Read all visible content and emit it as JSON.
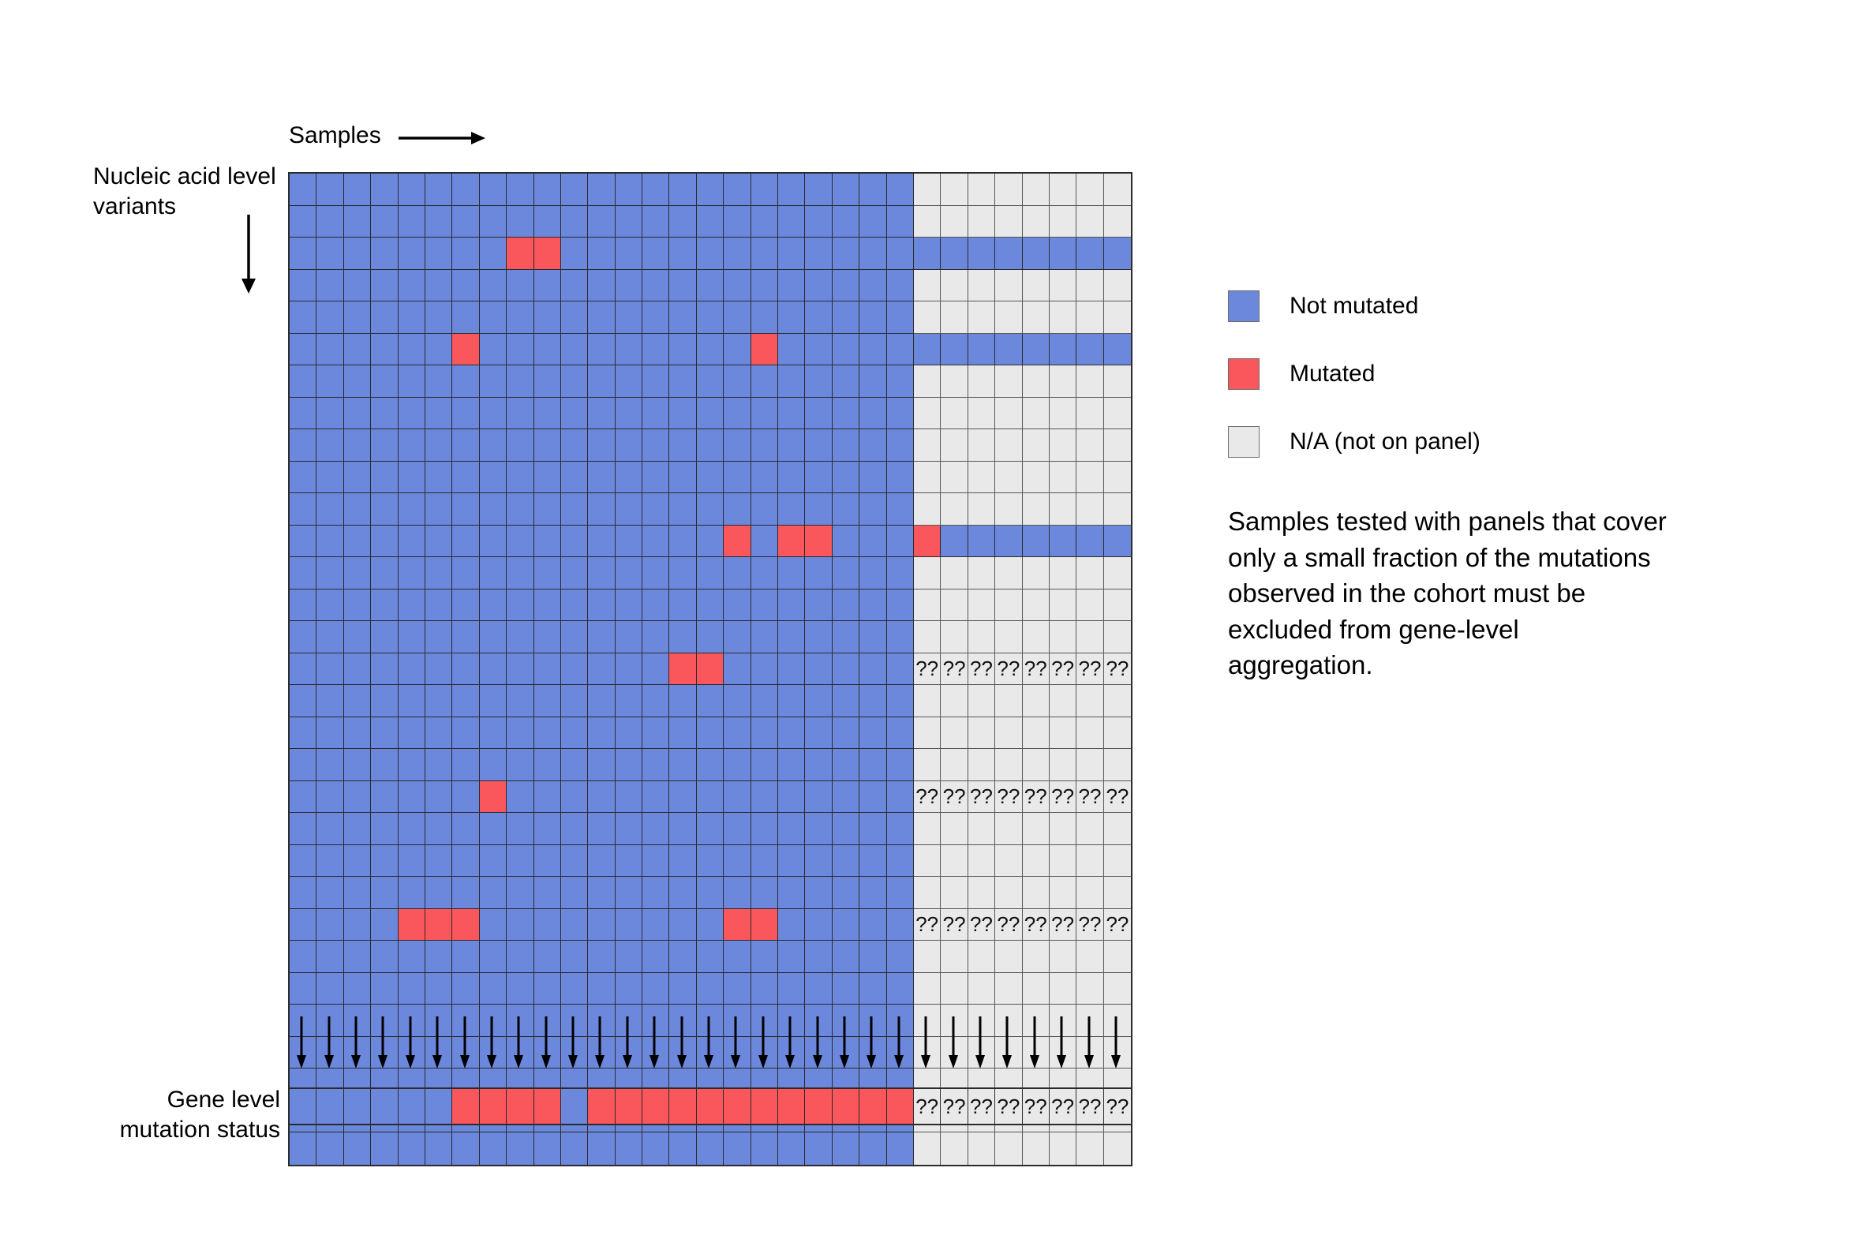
{
  "labels": {
    "samples": "Samples",
    "nucleic_acid_variants": "Nucleic acid level\nvariants",
    "gene_level": "Gene level\nmutation status"
  },
  "legend": {
    "items": [
      {
        "label": "Not mutated",
        "color": "#6b88dd",
        "state": "blue"
      },
      {
        "label": "Mutated",
        "color": "#f9575c",
        "state": "red"
      },
      {
        "label": "N/A (not on panel)",
        "color": "#e9e9e9",
        "state": "na"
      }
    ]
  },
  "note": "Samples tested with panels that cover only a small fraction of the mutations observed in the cohort must be excluded from gene-level aggregation.",
  "unknown_marker": "?",
  "chart_data": {
    "type": "heatmap",
    "title": "Nucleic acid level variants by sample",
    "xlabel": "Samples",
    "ylabel": "Nucleic acid level variants",
    "columns": 31,
    "rows": 26,
    "panel_covered_columns": 23,
    "not_on_panel_columns": 8,
    "legend_position": "right",
    "value_colors": {
      "blue": "#6b88dd",
      "red": "#f9575c",
      "na": "#e9e9e9"
    },
    "matrix": [
      [
        "blue",
        "blue",
        "blue",
        "blue",
        "blue",
        "blue",
        "blue",
        "blue",
        "blue",
        "blue",
        "blue",
        "blue",
        "blue",
        "blue",
        "blue",
        "blue",
        "blue",
        "blue",
        "blue",
        "blue",
        "blue",
        "blue",
        "blue",
        "na",
        "na",
        "na",
        "na",
        "na",
        "na",
        "na",
        "na"
      ],
      [
        "blue",
        "blue",
        "blue",
        "blue",
        "blue",
        "blue",
        "blue",
        "blue",
        "blue",
        "blue",
        "blue",
        "blue",
        "blue",
        "blue",
        "blue",
        "blue",
        "blue",
        "blue",
        "blue",
        "blue",
        "blue",
        "blue",
        "blue",
        "na",
        "na",
        "na",
        "na",
        "na",
        "na",
        "na",
        "na"
      ],
      [
        "blue",
        "blue",
        "blue",
        "blue",
        "blue",
        "blue",
        "blue",
        "blue",
        "red",
        "red",
        "blue",
        "blue",
        "blue",
        "blue",
        "blue",
        "blue",
        "blue",
        "blue",
        "blue",
        "blue",
        "blue",
        "blue",
        "blue",
        "blue",
        "blue",
        "blue",
        "blue",
        "blue",
        "blue",
        "blue",
        "blue"
      ],
      [
        "blue",
        "blue",
        "blue",
        "blue",
        "blue",
        "blue",
        "blue",
        "blue",
        "blue",
        "blue",
        "blue",
        "blue",
        "blue",
        "blue",
        "blue",
        "blue",
        "blue",
        "blue",
        "blue",
        "blue",
        "blue",
        "blue",
        "blue",
        "na",
        "na",
        "na",
        "na",
        "na",
        "na",
        "na",
        "na"
      ],
      [
        "blue",
        "blue",
        "blue",
        "blue",
        "blue",
        "blue",
        "blue",
        "blue",
        "blue",
        "blue",
        "blue",
        "blue",
        "blue",
        "blue",
        "blue",
        "blue",
        "blue",
        "blue",
        "blue",
        "blue",
        "blue",
        "blue",
        "blue",
        "na",
        "na",
        "na",
        "na",
        "na",
        "na",
        "na",
        "na"
      ],
      [
        "blue",
        "blue",
        "blue",
        "blue",
        "blue",
        "blue",
        "red",
        "blue",
        "blue",
        "blue",
        "blue",
        "blue",
        "blue",
        "blue",
        "blue",
        "blue",
        "blue",
        "red",
        "blue",
        "blue",
        "blue",
        "blue",
        "blue",
        "blue",
        "blue",
        "blue",
        "blue",
        "blue",
        "blue",
        "blue",
        "blue"
      ],
      [
        "blue",
        "blue",
        "blue",
        "blue",
        "blue",
        "blue",
        "blue",
        "blue",
        "blue",
        "blue",
        "blue",
        "blue",
        "blue",
        "blue",
        "blue",
        "blue",
        "blue",
        "blue",
        "blue",
        "blue",
        "blue",
        "blue",
        "blue",
        "na",
        "na",
        "na",
        "na",
        "na",
        "na",
        "na",
        "na"
      ],
      [
        "blue",
        "blue",
        "blue",
        "blue",
        "blue",
        "blue",
        "blue",
        "blue",
        "blue",
        "blue",
        "blue",
        "blue",
        "blue",
        "blue",
        "blue",
        "blue",
        "blue",
        "blue",
        "blue",
        "blue",
        "blue",
        "blue",
        "blue",
        "na",
        "na",
        "na",
        "na",
        "na",
        "na",
        "na",
        "na"
      ],
      [
        "blue",
        "blue",
        "blue",
        "blue",
        "blue",
        "blue",
        "blue",
        "blue",
        "blue",
        "blue",
        "blue",
        "blue",
        "blue",
        "blue",
        "blue",
        "blue",
        "blue",
        "blue",
        "blue",
        "blue",
        "blue",
        "blue",
        "blue",
        "na",
        "na",
        "na",
        "na",
        "na",
        "na",
        "na",
        "na"
      ],
      [
        "blue",
        "blue",
        "blue",
        "blue",
        "blue",
        "blue",
        "blue",
        "blue",
        "blue",
        "blue",
        "blue",
        "blue",
        "blue",
        "blue",
        "blue",
        "blue",
        "blue",
        "blue",
        "blue",
        "blue",
        "blue",
        "blue",
        "blue",
        "na",
        "na",
        "na",
        "na",
        "na",
        "na",
        "na",
        "na"
      ],
      [
        "blue",
        "blue",
        "blue",
        "blue",
        "blue",
        "blue",
        "blue",
        "blue",
        "blue",
        "blue",
        "blue",
        "blue",
        "blue",
        "blue",
        "blue",
        "blue",
        "blue",
        "blue",
        "blue",
        "blue",
        "blue",
        "blue",
        "blue",
        "na",
        "na",
        "na",
        "na",
        "na",
        "na",
        "na",
        "na"
      ],
      [
        "blue",
        "blue",
        "blue",
        "blue",
        "blue",
        "blue",
        "blue",
        "blue",
        "blue",
        "blue",
        "blue",
        "blue",
        "blue",
        "blue",
        "blue",
        "blue",
        "red",
        "blue",
        "red",
        "red",
        "blue",
        "blue",
        "blue",
        "red",
        "blue",
        "blue",
        "blue",
        "blue",
        "blue",
        "blue",
        "blue"
      ],
      [
        "blue",
        "blue",
        "blue",
        "blue",
        "blue",
        "blue",
        "blue",
        "blue",
        "blue",
        "blue",
        "blue",
        "blue",
        "blue",
        "blue",
        "blue",
        "blue",
        "blue",
        "blue",
        "blue",
        "blue",
        "blue",
        "blue",
        "blue",
        "na",
        "na",
        "na",
        "na",
        "na",
        "na",
        "na",
        "na"
      ],
      [
        "blue",
        "blue",
        "blue",
        "blue",
        "blue",
        "blue",
        "blue",
        "blue",
        "blue",
        "blue",
        "blue",
        "blue",
        "blue",
        "blue",
        "blue",
        "blue",
        "blue",
        "blue",
        "blue",
        "blue",
        "blue",
        "blue",
        "blue",
        "na",
        "na",
        "na",
        "na",
        "na",
        "na",
        "na",
        "na"
      ],
      [
        "blue",
        "blue",
        "blue",
        "blue",
        "blue",
        "blue",
        "blue",
        "blue",
        "blue",
        "blue",
        "blue",
        "blue",
        "blue",
        "blue",
        "blue",
        "blue",
        "blue",
        "blue",
        "blue",
        "blue",
        "blue",
        "blue",
        "blue",
        "na",
        "na",
        "na",
        "na",
        "na",
        "na",
        "na",
        "na"
      ],
      [
        "blue",
        "blue",
        "blue",
        "blue",
        "blue",
        "blue",
        "blue",
        "blue",
        "blue",
        "blue",
        "blue",
        "blue",
        "blue",
        "blue",
        "red",
        "red",
        "blue",
        "blue",
        "blue",
        "blue",
        "blue",
        "blue",
        "blue",
        "q",
        "q",
        "q",
        "q",
        "q",
        "q",
        "q",
        "q"
      ],
      [
        "blue",
        "blue",
        "blue",
        "blue",
        "blue",
        "blue",
        "blue",
        "blue",
        "blue",
        "blue",
        "blue",
        "blue",
        "blue",
        "blue",
        "blue",
        "blue",
        "blue",
        "blue",
        "blue",
        "blue",
        "blue",
        "blue",
        "blue",
        "na",
        "na",
        "na",
        "na",
        "na",
        "na",
        "na",
        "na"
      ],
      [
        "blue",
        "blue",
        "blue",
        "blue",
        "blue",
        "blue",
        "blue",
        "blue",
        "blue",
        "blue",
        "blue",
        "blue",
        "blue",
        "blue",
        "blue",
        "blue",
        "blue",
        "blue",
        "blue",
        "blue",
        "blue",
        "blue",
        "blue",
        "na",
        "na",
        "na",
        "na",
        "na",
        "na",
        "na",
        "na"
      ],
      [
        "blue",
        "blue",
        "blue",
        "blue",
        "blue",
        "blue",
        "blue",
        "blue",
        "blue",
        "blue",
        "blue",
        "blue",
        "blue",
        "blue",
        "blue",
        "blue",
        "blue",
        "blue",
        "blue",
        "blue",
        "blue",
        "blue",
        "blue",
        "na",
        "na",
        "na",
        "na",
        "na",
        "na",
        "na",
        "na"
      ],
      [
        "blue",
        "blue",
        "blue",
        "blue",
        "blue",
        "blue",
        "blue",
        "red",
        "blue",
        "blue",
        "blue",
        "blue",
        "blue",
        "blue",
        "blue",
        "blue",
        "blue",
        "blue",
        "blue",
        "blue",
        "blue",
        "blue",
        "blue",
        "q",
        "q",
        "q",
        "q",
        "q",
        "q",
        "q",
        "q"
      ],
      [
        "blue",
        "blue",
        "blue",
        "blue",
        "blue",
        "blue",
        "blue",
        "blue",
        "blue",
        "blue",
        "blue",
        "blue",
        "blue",
        "blue",
        "blue",
        "blue",
        "blue",
        "blue",
        "blue",
        "blue",
        "blue",
        "blue",
        "blue",
        "na",
        "na",
        "na",
        "na",
        "na",
        "na",
        "na",
        "na"
      ],
      [
        "blue",
        "blue",
        "blue",
        "blue",
        "blue",
        "blue",
        "blue",
        "blue",
        "blue",
        "blue",
        "blue",
        "blue",
        "blue",
        "blue",
        "blue",
        "blue",
        "blue",
        "blue",
        "blue",
        "blue",
        "blue",
        "blue",
        "blue",
        "na",
        "na",
        "na",
        "na",
        "na",
        "na",
        "na",
        "na"
      ],
      [
        "blue",
        "blue",
        "blue",
        "blue",
        "blue",
        "blue",
        "blue",
        "blue",
        "blue",
        "blue",
        "blue",
        "blue",
        "blue",
        "blue",
        "blue",
        "blue",
        "blue",
        "blue",
        "blue",
        "blue",
        "blue",
        "blue",
        "blue",
        "na",
        "na",
        "na",
        "na",
        "na",
        "na",
        "na",
        "na"
      ],
      [
        "blue",
        "blue",
        "blue",
        "blue",
        "red",
        "red",
        "red",
        "blue",
        "blue",
        "blue",
        "blue",
        "blue",
        "blue",
        "blue",
        "blue",
        "blue",
        "red",
        "red",
        "blue",
        "blue",
        "blue",
        "blue",
        "blue",
        "q",
        "q",
        "q",
        "q",
        "q",
        "q",
        "q",
        "q"
      ],
      [
        "blue",
        "blue",
        "blue",
        "blue",
        "blue",
        "blue",
        "blue",
        "blue",
        "blue",
        "blue",
        "blue",
        "blue",
        "blue",
        "blue",
        "blue",
        "blue",
        "blue",
        "blue",
        "blue",
        "blue",
        "blue",
        "blue",
        "blue",
        "na",
        "na",
        "na",
        "na",
        "na",
        "na",
        "na",
        "na"
      ],
      [
        "blue",
        "blue",
        "blue",
        "blue",
        "blue",
        "blue",
        "blue",
        "blue",
        "blue",
        "blue",
        "blue",
        "blue",
        "blue",
        "blue",
        "blue",
        "blue",
        "blue",
        "blue",
        "blue",
        "blue",
        "blue",
        "blue",
        "blue",
        "na",
        "na",
        "na",
        "na",
        "na",
        "na",
        "na",
        "na"
      ],
      [
        "blue",
        "blue",
        "blue",
        "blue",
        "blue",
        "blue",
        "blue",
        "blue",
        "blue",
        "blue",
        "blue",
        "blue",
        "blue",
        "blue",
        "blue",
        "blue",
        "blue",
        "blue",
        "blue",
        "blue",
        "blue",
        "blue",
        "blue",
        "na",
        "na",
        "na",
        "na",
        "na",
        "na",
        "na",
        "na"
      ],
      [
        "blue",
        "blue",
        "blue",
        "blue",
        "blue",
        "blue",
        "blue",
        "blue",
        "blue",
        "blue",
        "blue",
        "blue",
        "blue",
        "blue",
        "blue",
        "blue",
        "blue",
        "blue",
        "blue",
        "blue",
        "blue",
        "blue",
        "blue",
        "na",
        "na",
        "na",
        "na",
        "na",
        "na",
        "na",
        "na"
      ],
      [
        "blue",
        "blue",
        "blue",
        "blue",
        "blue",
        "blue",
        "blue",
        "blue",
        "blue",
        "blue",
        "blue",
        "blue",
        "blue",
        "blue",
        "blue",
        "blue",
        "blue",
        "blue",
        "blue",
        "blue",
        "blue",
        "blue",
        "blue",
        "na",
        "na",
        "na",
        "na",
        "na",
        "na",
        "na",
        "na"
      ],
      [
        "blue",
        "blue",
        "blue",
        "blue",
        "blue",
        "blue",
        "blue",
        "blue",
        "blue",
        "blue",
        "blue",
        "blue",
        "blue",
        "blue",
        "blue",
        "blue",
        "blue",
        "blue",
        "blue",
        "blue",
        "blue",
        "blue",
        "blue",
        "na",
        "na",
        "na",
        "na",
        "na",
        "na",
        "na",
        "na"
      ],
      [
        "blue",
        "blue",
        "blue",
        "blue",
        "blue",
        "blue",
        "blue",
        "blue",
        "blue",
        "blue",
        "blue",
        "blue",
        "blue",
        "blue",
        "blue",
        "blue",
        "blue",
        "blue",
        "blue",
        "blue",
        "blue",
        "blue",
        "blue",
        "na",
        "na",
        "na",
        "na",
        "na",
        "na",
        "na",
        "na"
      ]
    ],
    "gene_level_row": [
      "blue",
      "blue",
      "blue",
      "blue",
      "blue",
      "blue",
      "red",
      "red",
      "red",
      "red",
      "blue",
      "red",
      "red",
      "red",
      "red",
      "red",
      "red",
      "red",
      "red",
      "red",
      "red",
      "red",
      "red",
      "q",
      "q",
      "q",
      "q",
      "q",
      "q",
      "q",
      "q"
    ],
    "arrows_count": 31
  }
}
